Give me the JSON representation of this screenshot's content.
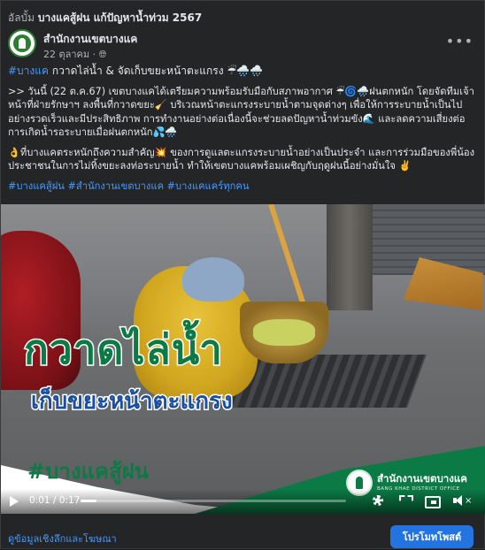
{
  "album": {
    "prefix": "อัลบั้ม",
    "name": "บางแคสู้ฝน แก้ปัญหาน้ำท่วม 2567"
  },
  "post": {
    "page_name": "สำนักงานเขตบางแค",
    "date": "22 ตุลาคม",
    "privacy_icon": "globe-icon",
    "more_label": "•••",
    "headline_tag": "#บางแค",
    "headline_text": " กวาดไล่น้ำ & จัดเก็บขยะหน้าตะแกรง ☔🌧️🌧️",
    "paragraph1": ">> วันนี้ (22 ต.ค.67) เขตบางแคได้เตรียมความพร้อมรับมือกับสภาพอากาศ ☔🌀🌧️ฝนตกหนัก โดยจัดทีมเจ้าหน้าที่ฝ่ายรักษาฯ ลงพื้นที่กวาดขยะ🧹 บริเวณหน้าตะแกรงระบายน้ำตามจุดต่างๆ เพื่อให้การระบายน้ำเป็นไปอย่างรวดเร็วและมีประสิทธิภาพ การทำงานอย่างต่อเนื่องนี้จะช่วยลดปัญหาน้ำท่วมขัง🌊 และลดความเสี่ยงต่อการเกิดน้ำรอระบายเมื่อฝนตกหนัก💦🌧️",
    "paragraph2": "👌ที่บางแคตระหนักถึงความสำคัญ💥 ของการดูแลตะแกรงระบายน้ำอย่างเป็นประจำ และการร่วมมือของพี่น้องประชาชนในการไม่ทิ้งขยะลงท่อระบายน้ำ ทำให้เขตบางแคพร้อมเผชิญกับฤดูฝนนี้อย่างมั่นใจ ✌️",
    "hashtags": "#บางแคสู้ฝน #สำนักงานเขตบางแค #บางแคแคร์ทุกคน"
  },
  "video": {
    "title": "กวาดไล่น้ำ",
    "subtitle": "เก็บขยะหน้าตะแกรง",
    "hashtag": "#บางแคสู้ฝน",
    "office_name": "สำนักงานเขตบางแค",
    "office_name_en": "BANG KHAE DISTRICT OFFICE",
    "time": "0:01 / 0:17",
    "progress": 0.06
  },
  "footer": {
    "insights_label": "ดูข้อมูลเชิงลึกและโฆษณา",
    "boost_label": "โปรโมทโพสต์"
  },
  "colors": {
    "background": "#242526",
    "link": "#4599ff",
    "brand_green": "#0b7a45",
    "boost": "#2374e1"
  }
}
